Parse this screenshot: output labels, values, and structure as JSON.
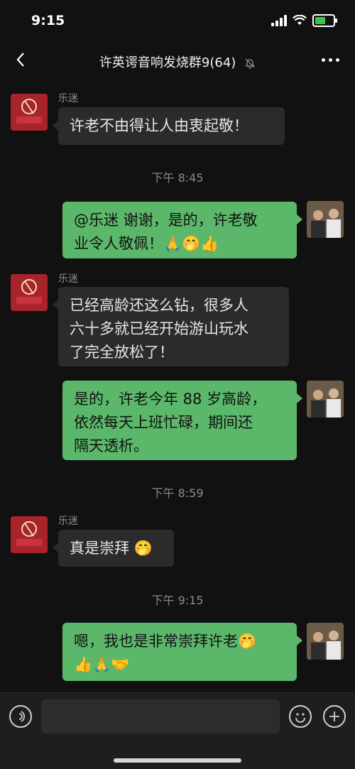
{
  "status_bar": {
    "time": "9:15"
  },
  "header": {
    "title": "许英谔音响发烧群9(64)",
    "muted_icon": "bell-off-icon",
    "more_icon": "more-icon",
    "back_icon": "chevron-left-icon"
  },
  "messages": [
    {
      "type": "in",
      "sender": "乐迷",
      "avatar": "beats-logo",
      "lines": [
        "许老不由得让人由衷起敬！"
      ]
    },
    {
      "type": "time",
      "text": "下午 8:45"
    },
    {
      "type": "out",
      "lines": [
        "@乐迷 谢谢，是的，许老敬",
        "业令人敬佩！🙏🤭👍"
      ]
    },
    {
      "type": "in",
      "sender": "乐迷",
      "avatar": "beats-logo",
      "lines": [
        "已经高龄还这么钻，很多人",
        "六十多就已经开始游山玩水",
        "了完全放松了！"
      ]
    },
    {
      "type": "out",
      "lines": [
        "是的，许老今年 88 岁高龄，",
        "依然每天上班忙碌，期间还",
        "隔天透析。"
      ]
    },
    {
      "type": "time",
      "text": "下午 8:59"
    },
    {
      "type": "in",
      "sender": "乐迷",
      "avatar": "beats-logo",
      "lines": [
        "真是崇拜 🤭"
      ]
    },
    {
      "type": "time",
      "text": "下午 9:15"
    },
    {
      "type": "out",
      "lines": [
        "嗯，我也是非常崇拜许老🤭",
        "👍🙏🤝"
      ]
    }
  ],
  "avatar_text": "BEATS 乐迷",
  "composer": {
    "voice_icon": "voice-icon",
    "emoji_icon": "emoji-icon",
    "plus_icon": "plus-icon"
  },
  "colors": {
    "background": "#111111",
    "incoming_bubble": "#2b2b2b",
    "outgoing_bubble": "#5bb76a"
  }
}
